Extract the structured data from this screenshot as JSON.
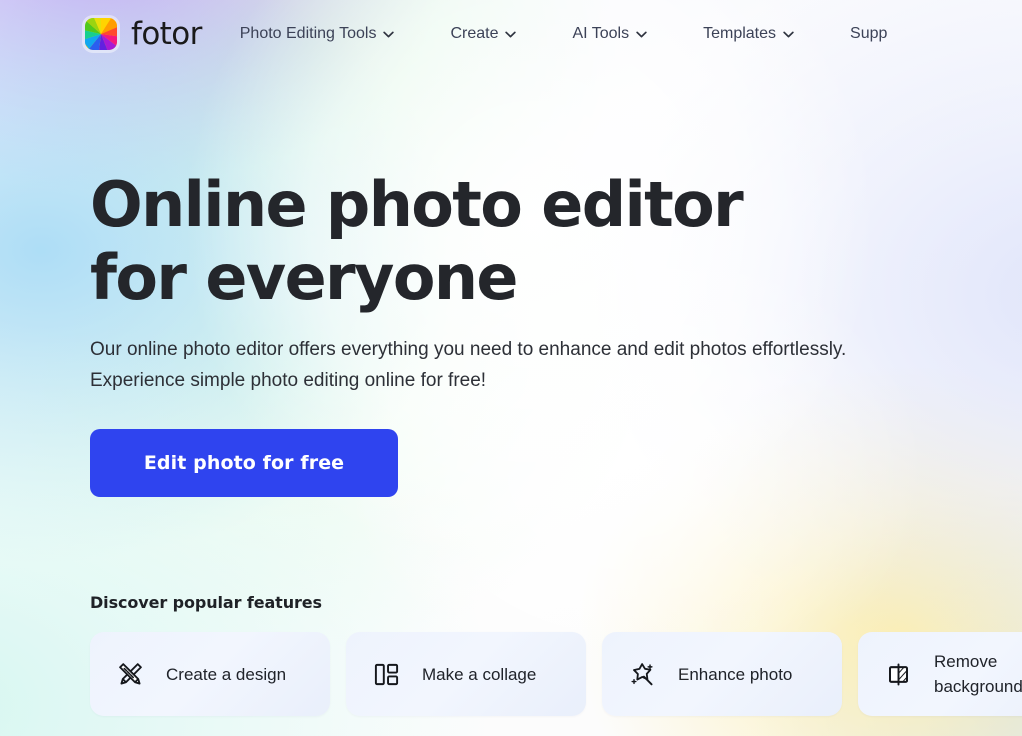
{
  "header": {
    "brand_name": "fotor",
    "logo_icon": "fotor-color-wheel-logo",
    "nav_items": [
      {
        "label": "Photo Editing Tools",
        "has_dropdown": true,
        "icon": "chevron-down-icon"
      },
      {
        "label": "Create",
        "has_dropdown": true,
        "icon": "chevron-down-icon"
      },
      {
        "label": "AI Tools",
        "has_dropdown": true,
        "icon": "chevron-down-icon"
      },
      {
        "label": "Templates",
        "has_dropdown": true,
        "icon": "chevron-down-icon"
      },
      {
        "label": "Supp",
        "has_dropdown": false,
        "icon": ""
      }
    ]
  },
  "hero": {
    "title": "Online photo editor for everyone",
    "subtitle": "Our online photo editor offers everything you need to enhance and edit photos effortlessly. Experience simple photo editing online for free!",
    "cta_label": "Edit photo for free",
    "cta_color": "#2f44ef"
  },
  "features": {
    "heading": "Discover popular features",
    "cards": [
      {
        "label": "Create a design",
        "icon": "pencil-ruler-cross-icon"
      },
      {
        "label": "Make a collage",
        "icon": "collage-layout-icon"
      },
      {
        "label": "Enhance photo",
        "icon": "magic-wand-sparkle-icon"
      },
      {
        "label": "Remove background",
        "icon": "remove-background-icon"
      }
    ],
    "card_background": "#eef3fd"
  },
  "background": {
    "accent_purple": "#c6a8f3",
    "accent_blue": "#a8dbf6",
    "accent_mint": "#cdf6d6",
    "accent_teal": "#d4f6f0",
    "accent_lavender": "#dfe4fa",
    "accent_yellow": "#fceeb0"
  }
}
